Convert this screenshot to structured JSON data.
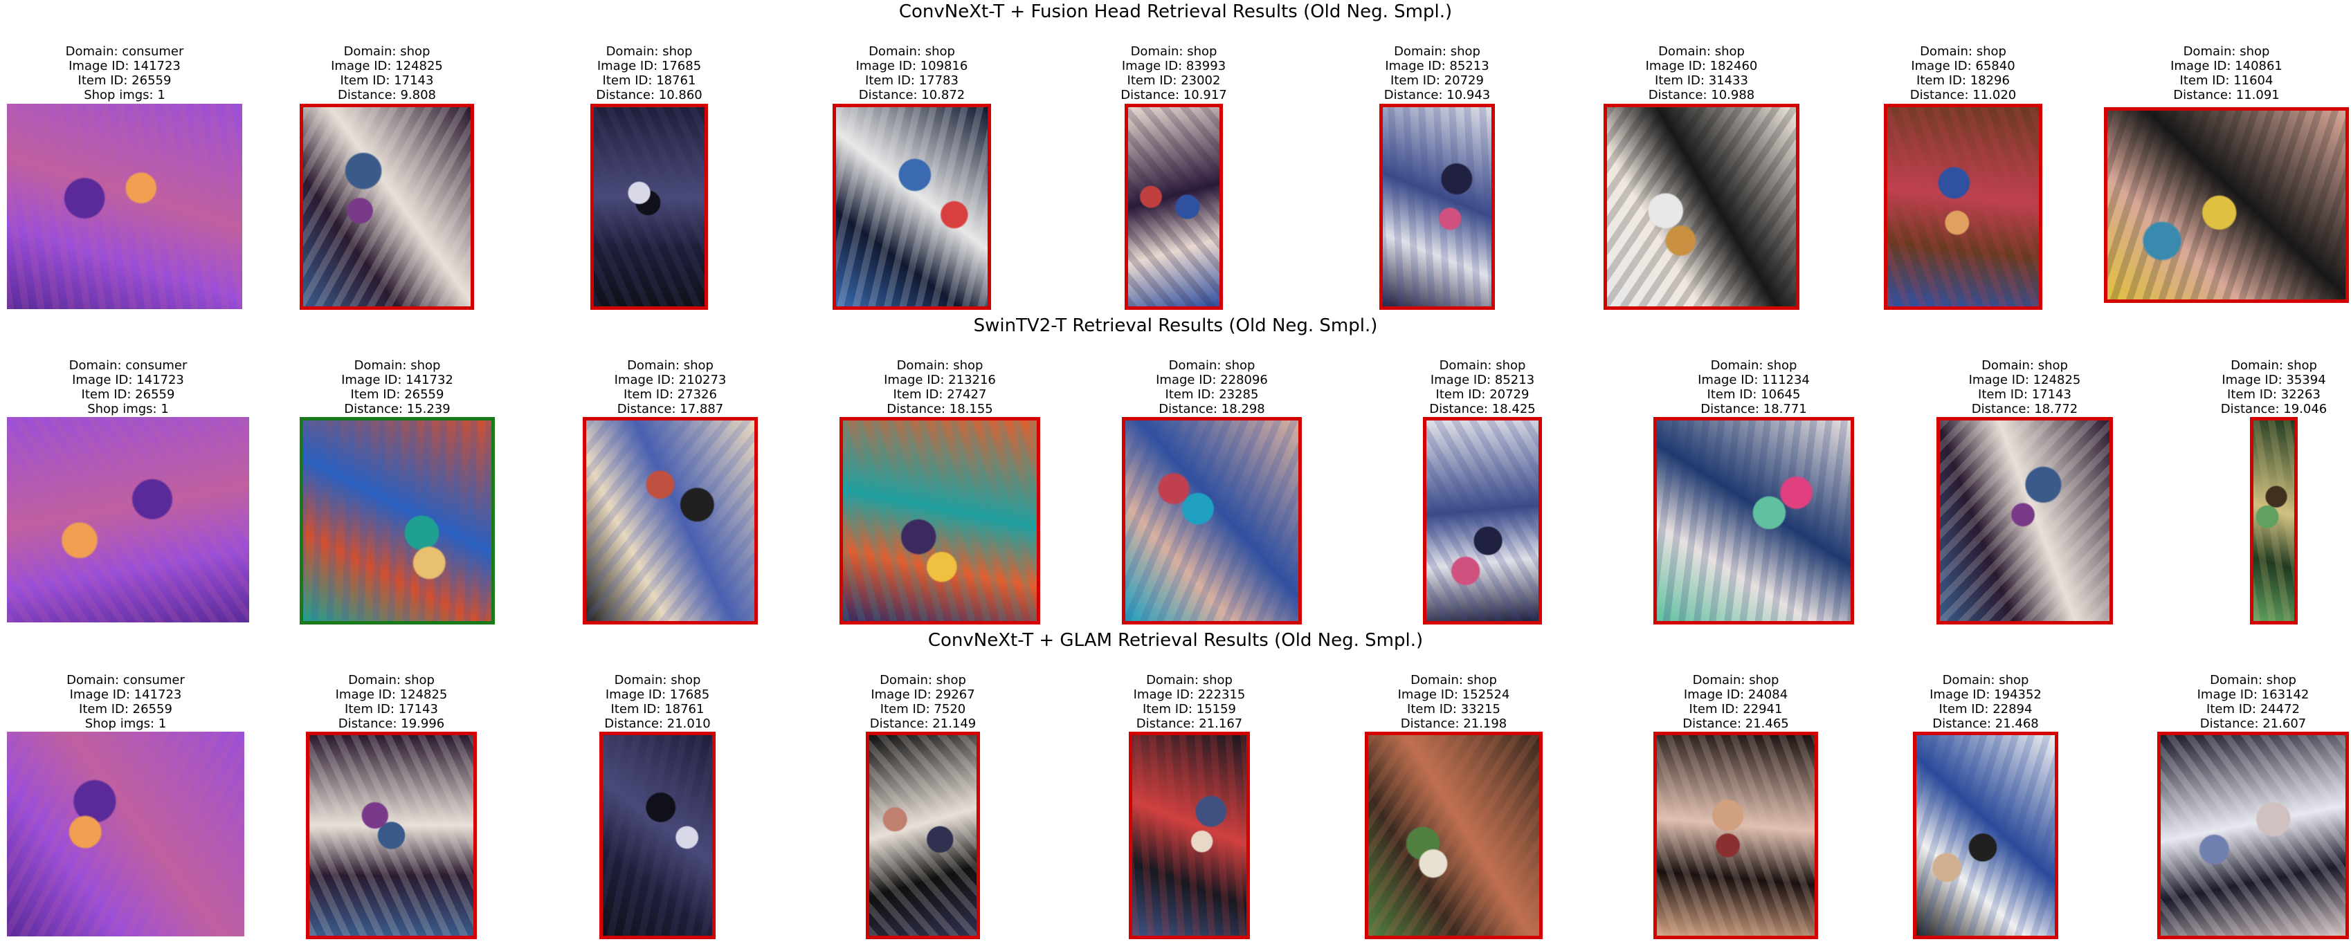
{
  "colors": {
    "incorrect_border": "#d40000",
    "correct_border": "#1a7a1a"
  },
  "rows": [
    {
      "title": "ConvNeXt-T + Fusion Head Retrieval Results (Old Neg. Smpl.)",
      "items": [
        {
          "lines": [
            "Domain: consumer",
            "Image ID: 141723",
            "Item ID: 26559",
            "Shop imgs: 1"
          ],
          "kind": "query",
          "palette": [
            "#9b4fd8",
            "#c060a0",
            "#f0a050",
            "#5a2a9a"
          ]
        },
        {
          "lines": [
            "Domain: shop",
            "Image ID: 124825",
            "Item ID: 17143",
            "Distance: 9.808"
          ],
          "kind": "wrong",
          "palette": [
            "#2a1a30",
            "#e8e0d8",
            "#7a3a8a",
            "#3a5a8a"
          ]
        },
        {
          "lines": [
            "Domain: shop",
            "Image ID: 17685",
            "Item ID: 18761",
            "Distance: 10.860"
          ],
          "kind": "wrong",
          "palette": [
            "#1e1e3a",
            "#4a4a7a",
            "#d8d8e8",
            "#10101a"
          ]
        },
        {
          "lines": [
            "Domain: shop",
            "Image ID: 109816",
            "Item ID: 17783",
            "Distance: 10.872"
          ],
          "kind": "wrong",
          "palette": [
            "#101830",
            "#e8e8e8",
            "#d84040",
            "#3a6ab0"
          ]
        },
        {
          "lines": [
            "Domain: shop",
            "Image ID: 83993",
            "Item ID: 23002",
            "Distance: 10.917"
          ],
          "kind": "wrong",
          "palette": [
            "#e8d8d0",
            "#2a1a3a",
            "#c04040",
            "#3050a0"
          ]
        },
        {
          "lines": [
            "Domain: shop",
            "Image ID: 85213",
            "Item ID: 20729",
            "Distance: 10.943"
          ],
          "kind": "wrong",
          "palette": [
            "#e0e0e8",
            "#3a4a8a",
            "#d05080",
            "#202040"
          ]
        },
        {
          "lines": [
            "Domain: shop",
            "Image ID: 182460",
            "Item ID: 31433",
            "Distance: 10.988"
          ],
          "kind": "wrong",
          "palette": [
            "#f0e8e0",
            "#181818",
            "#c89040",
            "#e8e8e8"
          ]
        },
        {
          "lines": [
            "Domain: shop",
            "Image ID: 65840",
            "Item ID: 18296",
            "Distance: 11.020"
          ],
          "kind": "wrong",
          "palette": [
            "#6a3a20",
            "#c04050",
            "#e0a060",
            "#3050a0"
          ]
        },
        {
          "lines": [
            "Domain: shop",
            "Image ID: 140861",
            "Item ID: 11604",
            "Distance: 11.091"
          ],
          "kind": "wrong",
          "palette": [
            "#d8a898",
            "#181818",
            "#3a8ab0",
            "#e0c040"
          ]
        }
      ]
    },
    {
      "title": "SwinTV2-T Retrieval Results (Old Neg. Smpl.)",
      "items": [
        {
          "lines": [
            "Domain: consumer",
            "Image ID: 141723",
            "Item ID: 26559",
            "Shop imgs: 1"
          ],
          "kind": "query",
          "palette": [
            "#9b4fd8",
            "#c060a0",
            "#f0a050",
            "#5a2a9a"
          ]
        },
        {
          "lines": [
            "Domain: shop",
            "Image ID: 141732",
            "Item ID: 26559",
            "Distance: 15.239"
          ],
          "kind": "right",
          "palette": [
            "#d05030",
            "#2a60c0",
            "#e8c070",
            "#20a090"
          ]
        },
        {
          "lines": [
            "Domain: shop",
            "Image ID: 210273",
            "Item ID: 27326",
            "Distance: 17.887"
          ],
          "kind": "wrong",
          "palette": [
            "#e8d8c0",
            "#4a60b0",
            "#c05040",
            "#202020"
          ]
        },
        {
          "lines": [
            "Domain: shop",
            "Image ID: 213216",
            "Item ID: 27427",
            "Distance: 18.155"
          ],
          "kind": "wrong",
          "palette": [
            "#e06030",
            "#20a0a0",
            "#f0c040",
            "#3a2a60"
          ]
        },
        {
          "lines": [
            "Domain: shop",
            "Image ID: 228096",
            "Item ID: 23285",
            "Distance: 18.298"
          ],
          "kind": "wrong",
          "palette": [
            "#d8b0a0",
            "#3050a0",
            "#c04050",
            "#20a0c0"
          ]
        },
        {
          "lines": [
            "Domain: shop",
            "Image ID: 85213",
            "Item ID: 20729",
            "Distance: 18.425"
          ],
          "kind": "wrong",
          "palette": [
            "#e0e0e8",
            "#3a4a8a",
            "#d05080",
            "#202040"
          ]
        },
        {
          "lines": [
            "Domain: shop",
            "Image ID: 111234",
            "Item ID: 10645",
            "Distance: 18.771"
          ],
          "kind": "wrong",
          "palette": [
            "#e8e0e0",
            "#203a70",
            "#e04080",
            "#60c0a0"
          ]
        },
        {
          "lines": [
            "Domain: shop",
            "Image ID: 124825",
            "Item ID: 17143",
            "Distance: 18.772"
          ],
          "kind": "wrong",
          "palette": [
            "#2a1a30",
            "#e8e0d8",
            "#7a3a8a",
            "#3a5a8a"
          ]
        },
        {
          "lines": [
            "Domain: shop",
            "Image ID: 35394",
            "Item ID: 32263",
            "Distance: 19.046"
          ],
          "kind": "wrong",
          "palette": [
            "#203a20",
            "#d0c080",
            "#403020",
            "#60a060"
          ]
        }
      ]
    },
    {
      "title": "ConvNeXt-T + GLAM Retrieval Results (Old Neg. Smpl.)",
      "items": [
        {
          "lines": [
            "Domain: consumer",
            "Image ID: 141723",
            "Item ID: 26559",
            "Shop imgs: 1"
          ],
          "kind": "query",
          "palette": [
            "#9b4fd8",
            "#c060a0",
            "#f0a050",
            "#5a2a9a"
          ]
        },
        {
          "lines": [
            "Domain: shop",
            "Image ID: 124825",
            "Item ID: 17143",
            "Distance: 19.996"
          ],
          "kind": "wrong",
          "palette": [
            "#2a1a30",
            "#e8e0d8",
            "#7a3a8a",
            "#3a5a8a"
          ]
        },
        {
          "lines": [
            "Domain: shop",
            "Image ID: 17685",
            "Item ID: 18761",
            "Distance: 21.010"
          ],
          "kind": "wrong",
          "palette": [
            "#1e1e3a",
            "#4a4a7a",
            "#d8d8e8",
            "#10101a"
          ]
        },
        {
          "lines": [
            "Domain: shop",
            "Image ID: 29267",
            "Item ID: 7520",
            "Distance: 21.149"
          ],
          "kind": "wrong",
          "palette": [
            "#101010",
            "#e8e0d8",
            "#c08070",
            "#303050"
          ]
        },
        {
          "lines": [
            "Domain: shop",
            "Image ID: 222315",
            "Item ID: 15159",
            "Distance: 21.167"
          ],
          "kind": "wrong",
          "palette": [
            "#181820",
            "#d04040",
            "#e8d8c8",
            "#405080"
          ]
        },
        {
          "lines": [
            "Domain: shop",
            "Image ID: 152524",
            "Item ID: 33215",
            "Distance: 21.198"
          ],
          "kind": "wrong",
          "palette": [
            "#3a2a20",
            "#c07050",
            "#e8e0d0",
            "#508040"
          ]
        },
        {
          "lines": [
            "Domain: shop",
            "Image ID: 24084",
            "Item ID: 22941",
            "Distance: 21.465"
          ],
          "kind": "wrong",
          "palette": [
            "#181010",
            "#e0c0b0",
            "#8a3030",
            "#d0a080"
          ]
        },
        {
          "lines": [
            "Domain: shop",
            "Image ID: 194352",
            "Item ID: 22894",
            "Distance: 21.468"
          ],
          "kind": "wrong",
          "palette": [
            "#f0f0f0",
            "#2a4a9a",
            "#d0b090",
            "#202020"
          ]
        },
        {
          "lines": [
            "Domain: shop",
            "Image ID: 163142",
            "Item ID: 24472",
            "Distance: 21.607"
          ],
          "kind": "wrong",
          "palette": [
            "#1a1a2a",
            "#e8e8f0",
            "#7080b0",
            "#d0c0c0"
          ]
        }
      ]
    }
  ]
}
